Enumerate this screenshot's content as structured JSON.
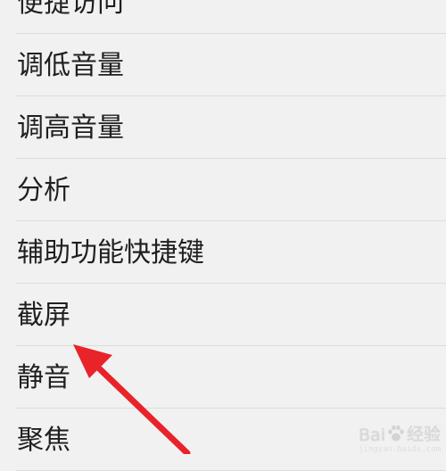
{
  "menu": {
    "items": [
      {
        "label": "便捷访问"
      },
      {
        "label": "调低音量"
      },
      {
        "label": "调高音量"
      },
      {
        "label": "分析"
      },
      {
        "label": "辅助功能快捷键"
      },
      {
        "label": "截屏"
      },
      {
        "label": "静音"
      },
      {
        "label": "聚焦"
      }
    ]
  },
  "annotation": {
    "arrow_color": "#e8232a"
  },
  "watermark": {
    "brand_prefix": "Bai",
    "brand_suffix": "经验",
    "url": "jingyan.baidu.com"
  }
}
